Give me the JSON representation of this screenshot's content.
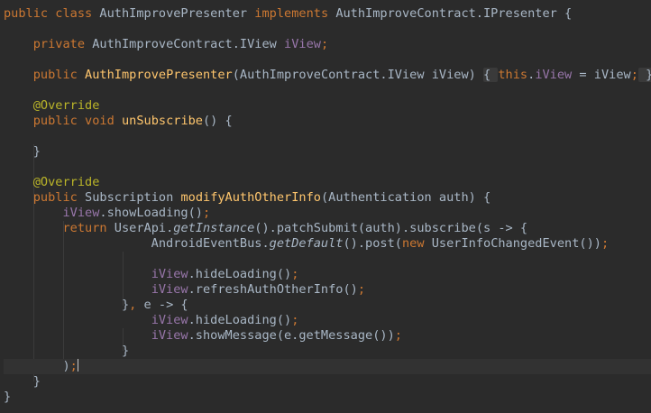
{
  "editor": {
    "colors": {
      "background": "#2b2b2b",
      "keyword": "#cc7832",
      "plain": "#a9b7c6",
      "method": "#ffc66d",
      "field": "#9876aa",
      "annotation": "#bbb529",
      "current_line": "#323232"
    },
    "lines": [
      [
        [
          "kw",
          "public class "
        ],
        [
          "plain",
          "AuthImprovePresenter "
        ],
        [
          "kw",
          "implements "
        ],
        [
          "plain",
          "AuthImproveContract.IPresenter {"
        ]
      ],
      [],
      [
        [
          "plain",
          "    "
        ],
        [
          "kw",
          "private "
        ],
        [
          "plain",
          "AuthImproveContract.IView "
        ],
        [
          "field",
          "iView"
        ],
        [
          "kw",
          ";"
        ]
      ],
      [],
      [
        [
          "plain",
          "    "
        ],
        [
          "kw",
          "public "
        ],
        [
          "method",
          "AuthImprovePresenter"
        ],
        [
          "plain",
          "(AuthImproveContract.IView iView) "
        ],
        [
          "fold",
          "{ "
        ],
        [
          "kw",
          "this"
        ],
        [
          "plain",
          "."
        ],
        [
          "field",
          "iView"
        ],
        [
          "plain",
          " = iView"
        ],
        [
          "kw",
          ";"
        ],
        [
          "fold",
          " }"
        ]
      ],
      [],
      [
        [
          "plain",
          "    "
        ],
        [
          "annotation",
          "@Override"
        ]
      ],
      [
        [
          "plain",
          "    "
        ],
        [
          "kw",
          "public void "
        ],
        [
          "method",
          "unSubscribe"
        ],
        [
          "plain",
          "() {"
        ]
      ],
      [],
      [
        [
          "plain",
          "    }"
        ]
      ],
      [],
      [
        [
          "plain",
          "    "
        ],
        [
          "annotation",
          "@Override"
        ]
      ],
      [
        [
          "plain",
          "    "
        ],
        [
          "kw",
          "public "
        ],
        [
          "plain",
          "Subscription "
        ],
        [
          "method",
          "modifyAuthOtherInfo"
        ],
        [
          "plain",
          "(Authentication auth) {"
        ]
      ],
      [
        [
          "plain",
          "        "
        ],
        [
          "field",
          "iView"
        ],
        [
          "plain",
          ".showLoading()"
        ],
        [
          "kw",
          ";"
        ]
      ],
      [
        [
          "plain",
          "        "
        ],
        [
          "kw",
          "return "
        ],
        [
          "plain",
          "UserApi."
        ],
        [
          "italic",
          "getInstance"
        ],
        [
          "plain",
          "().patchSubmit(auth).subscribe(s -> {"
        ]
      ],
      [
        [
          "plain",
          "                    AndroidEventBus."
        ],
        [
          "italic",
          "getDefault"
        ],
        [
          "plain",
          "().post("
        ],
        [
          "kw",
          "new "
        ],
        [
          "plain",
          "UserInfoChangedEvent())"
        ],
        [
          "kw",
          ";"
        ]
      ],
      [],
      [
        [
          "plain",
          "                    "
        ],
        [
          "field",
          "iView"
        ],
        [
          "plain",
          ".hideLoading()"
        ],
        [
          "kw",
          ";"
        ]
      ],
      [
        [
          "plain",
          "                    "
        ],
        [
          "field",
          "iView"
        ],
        [
          "plain",
          ".refreshAuthOtherInfo()"
        ],
        [
          "kw",
          ";"
        ]
      ],
      [
        [
          "plain",
          "                }"
        ],
        [
          "kw",
          ", "
        ],
        [
          "plain",
          "e -> {"
        ]
      ],
      [
        [
          "plain",
          "                    "
        ],
        [
          "field",
          "iView"
        ],
        [
          "plain",
          ".hideLoading()"
        ],
        [
          "kw",
          ";"
        ]
      ],
      [
        [
          "plain",
          "                    "
        ],
        [
          "field",
          "iView"
        ],
        [
          "plain",
          ".showMessage(e.getMessage())"
        ],
        [
          "kw",
          ";"
        ]
      ],
      [
        [
          "plain",
          "                }"
        ]
      ],
      [
        [
          "plain",
          "        )"
        ],
        [
          "kw",
          ";"
        ],
        [
          "caret",
          ""
        ]
      ],
      [
        [
          "plain",
          "    }"
        ]
      ],
      [
        [
          "plain",
          "}"
        ]
      ]
    ]
  }
}
